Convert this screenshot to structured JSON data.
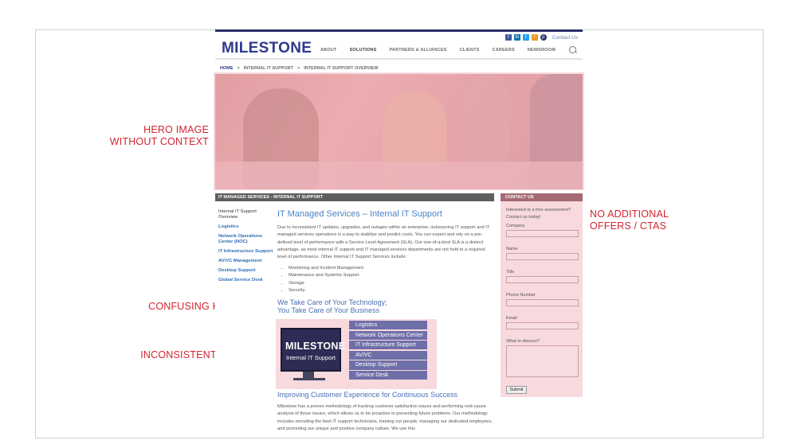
{
  "annotations": {
    "hero_line1": "HERO IMAGE",
    "hero_line2": "WITHOUT CONTEXT",
    "offers_line1": "NO ADDITIONAL",
    "offers_line2": "OFFERS / CTAS",
    "hierarchy": "CONFUSING HIERARCHY",
    "graphics": "INCONSISTENT GRAPHICS"
  },
  "site": {
    "logo": "MILESTONE",
    "contact_link": "Contact Us",
    "social_icons": [
      "facebook-icon",
      "linkedin-icon",
      "twitter-icon",
      "rss-icon",
      "pinterest-icon"
    ],
    "nav": [
      {
        "label": "ABOUT",
        "active": false
      },
      {
        "label": "SOLUTIONS",
        "active": true
      },
      {
        "label": "PARTNERS & ALLIANCES",
        "active": false
      },
      {
        "label": "CLIENTS",
        "active": false
      },
      {
        "label": "CAREERS",
        "active": false
      },
      {
        "label": "NEWSROOM",
        "active": false
      }
    ],
    "breadcrumbs": [
      "HOME",
      "INTERNAL IT SUPPORT",
      "INTERNAL IT SUPPORT OVERVIEW"
    ],
    "section_bar": "IT MANAGED SERVICES - INTERNAL IT SUPPORT",
    "sidebar": [
      "Internal IT Support Overview",
      "Logistics",
      "Network Operations Center (NOC)",
      "IT Infrastructure Support",
      "AV/VC Management",
      "Desktop Support",
      "Global Service Desk"
    ],
    "main": {
      "title": "IT Managed Services – Internal IT Support",
      "paragraph": "Due to inconsistent IT updates, upgrades, and outages within an enterprise, outsourcing IT support and IT managed services operations is a way to stabilize and predict costs. You can expect and rely on a pre-defined level of performance with a Service Level Agreement (SLA). Our one-of-a-kind SLA is a distinct advantage, as most internal IT support and IT managed services departments are not held to a required level of performance. Other Internal IT Support Services include:",
      "bullets": [
        "Monitoring and Incident Management",
        "Maintenance and Systems Support",
        "Storage",
        "Security"
      ],
      "subheading1_line1": "We Take Care of Your Technology;",
      "subheading1_line2": "You Take Care of Your Business",
      "graphic_logo": "MILESTONE",
      "graphic_sub": "Internal IT Support",
      "graphic_services": [
        "Logistics",
        "Network Operations Center",
        "IT Infrastructure Support",
        "AV/VC",
        "Desktop Support",
        "Service Desk"
      ],
      "subheading2": "Improving Customer Experience for Continuous Success",
      "paragraph2": "Milestone has a proven methodology of tracking customer satisfaction issues and performing root-cause analysis of those issues, which allows us to be proactive in preventing future problems. Our methodology includes recruiting the best IT support technicians, training our people, managing our dedicated employees, and promoting our unique and positive company culture. We use this"
    },
    "contact": {
      "header": "CONTACT US",
      "intro": "Interested in a free assessment? Contact us today!",
      "fields": [
        "Company",
        "Name",
        "Title",
        "Phone Number",
        "Email"
      ],
      "textarea_label": "What to discuss?",
      "submit": "Submit"
    }
  }
}
